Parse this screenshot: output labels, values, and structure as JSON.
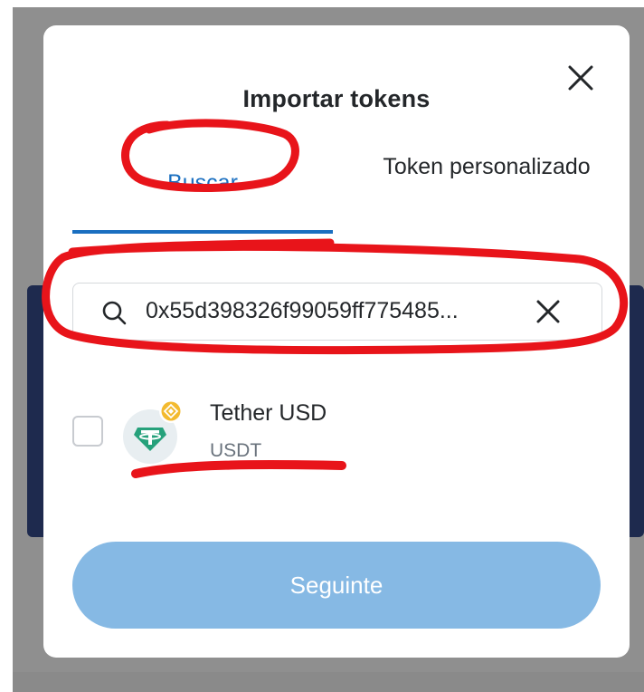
{
  "dialog": {
    "title": "Importar tokens"
  },
  "tabs": [
    {
      "label": "Buscar",
      "active": true
    },
    {
      "label": "Token personalizado",
      "active": false
    }
  ],
  "search": {
    "value": "0x55d398326f99059ff775485..."
  },
  "results": [
    {
      "name": "Tether USD",
      "symbol": "USDT",
      "checked": false
    }
  ],
  "footer": {
    "next_label": "Seguinte"
  },
  "colors": {
    "accent": "#1a6fc0",
    "button_disabled": "#86b9e4",
    "annotation": "#e8141a",
    "tether_green": "#26a17b"
  }
}
